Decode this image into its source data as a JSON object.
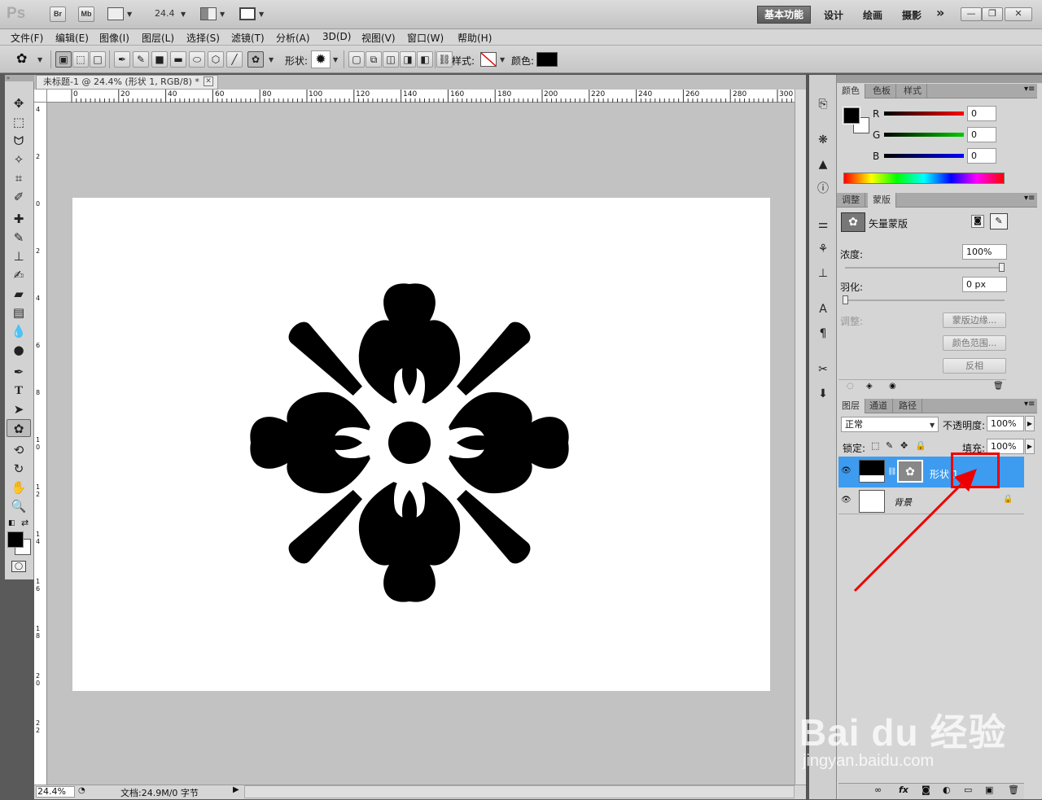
{
  "app": {
    "logo": "Ps",
    "bridge_btn": "Br",
    "minibridge_btn": "Mb",
    "zoom": "24.4",
    "workspaces": {
      "active": "基本功能",
      "items": [
        "设计",
        "绘画",
        "摄影"
      ],
      "more": "»"
    },
    "window_controls": {
      "min": "—",
      "restore": "❐",
      "close": "✕"
    }
  },
  "menu": [
    "文件(F)",
    "编辑(E)",
    "图像(I)",
    "图层(L)",
    "选择(S)",
    "滤镜(T)",
    "分析(A)",
    "3D(D)",
    "视图(V)",
    "窗口(W)",
    "帮助(H)"
  ],
  "options": {
    "shape_label": "形状:",
    "style_label": "样式:",
    "color_label": "颜色:",
    "color": "#000000"
  },
  "document": {
    "tab_title": "未标题-1 @ 24.4% (形状 1, RGB/8) *",
    "close": "✕"
  },
  "ruler": {
    "top": [
      "0",
      "20",
      "40",
      "60",
      "80",
      "100",
      "120",
      "140",
      "160",
      "180",
      "200",
      "220",
      "240",
      "260",
      "280",
      "300"
    ],
    "left": [
      "4",
      "2",
      "0",
      "2",
      "4",
      "6",
      "8",
      "10",
      "12",
      "14",
      "16",
      "18",
      "20",
      "22"
    ]
  },
  "status": {
    "zoom": "24.4%",
    "doc": "文档:24.9M/0 字节"
  },
  "color_panel": {
    "tabs": [
      "颜色",
      "色板",
      "样式"
    ],
    "labels": [
      "R",
      "G",
      "B"
    ],
    "values": [
      "0",
      "0",
      "0"
    ],
    "fg": "#000000",
    "bg": "#ffffff"
  },
  "masks_panel": {
    "tabs": [
      "调整",
      "蒙版"
    ],
    "title": "矢量蒙版",
    "density_label": "浓度:",
    "density": "100%",
    "feather_label": "羽化:",
    "feather": "0 px",
    "adjust_label": "调整:",
    "buttons": [
      "蒙版边缘...",
      "颜色范围...",
      "反相"
    ]
  },
  "layers_panel": {
    "tabs": [
      "图层",
      "通道",
      "路径"
    ],
    "blend": "正常",
    "opacity_label": "不透明度:",
    "opacity": "100%",
    "lock_label": "锁定:",
    "fill_label": "填充:",
    "fill": "100%",
    "layers": [
      {
        "name": "形状 1",
        "selected": true
      },
      {
        "name": "背景",
        "selected": false
      }
    ],
    "footer": [
      "∞",
      "fx",
      "◙",
      "◐",
      "▭",
      "▣",
      "🗑"
    ]
  },
  "watermark": {
    "line1": "Bai du 经验",
    "line2": "jingyan.baidu.com"
  }
}
